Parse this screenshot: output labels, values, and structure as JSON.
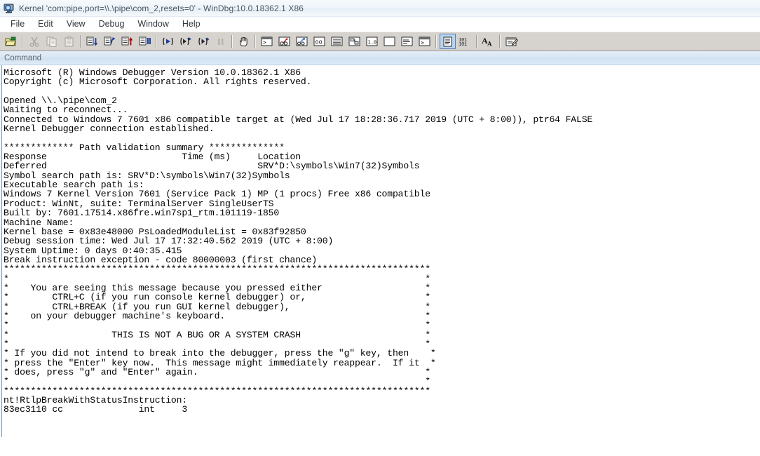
{
  "window": {
    "title": "Kernel 'com:pipe,port=\\\\.\\pipe\\com_2,resets=0' - WinDbg:10.0.18362.1 X86",
    "icon": "windbg-bug-icon"
  },
  "menubar": {
    "items": [
      {
        "label": "File",
        "name": "menu-file"
      },
      {
        "label": "Edit",
        "name": "menu-edit"
      },
      {
        "label": "View",
        "name": "menu-view"
      },
      {
        "label": "Debug",
        "name": "menu-debug"
      },
      {
        "label": "Window",
        "name": "menu-window"
      },
      {
        "label": "Help",
        "name": "menu-help"
      }
    ]
  },
  "toolbar": {
    "buttons": [
      {
        "name": "open-source-file-icon",
        "icon": "folder-open",
        "state": "enabled"
      },
      {
        "sep": true
      },
      {
        "name": "cut-icon",
        "icon": "cut",
        "state": "disabled"
      },
      {
        "name": "copy-icon",
        "icon": "copy",
        "state": "disabled"
      },
      {
        "name": "paste-icon",
        "icon": "paste",
        "state": "disabled"
      },
      {
        "sep": true
      },
      {
        "name": "step-into-icon",
        "icon": "step-into",
        "state": "enabled"
      },
      {
        "name": "step-over-icon",
        "icon": "step-over",
        "state": "enabled"
      },
      {
        "name": "step-out-icon",
        "icon": "step-out",
        "state": "enabled"
      },
      {
        "name": "run-to-cursor-icon",
        "icon": "run-to-cursor",
        "state": "enabled"
      },
      {
        "sep": true
      },
      {
        "name": "go-icon",
        "icon": "go",
        "state": "enabled"
      },
      {
        "name": "restart-icon",
        "icon": "restart",
        "state": "enabled"
      },
      {
        "name": "stop-debugging-icon",
        "icon": "stop-debug",
        "state": "enabled"
      },
      {
        "name": "break-icon",
        "icon": "break",
        "state": "disabled"
      },
      {
        "sep": true
      },
      {
        "name": "break-hand-icon",
        "icon": "hand",
        "state": "enabled"
      },
      {
        "sep": true
      },
      {
        "name": "command-window-icon",
        "icon": "command-window",
        "state": "enabled"
      },
      {
        "name": "watch-window-icon",
        "icon": "watch-window",
        "state": "enabled"
      },
      {
        "name": "locals-window-icon",
        "icon": "locals-window",
        "state": "enabled"
      },
      {
        "name": "registers-window-icon",
        "icon": "registers-window",
        "state": "enabled"
      },
      {
        "name": "memory-window-icon",
        "icon": "memory-window",
        "state": "enabled"
      },
      {
        "name": "call-stack-window-icon",
        "icon": "callstack-window",
        "state": "enabled"
      },
      {
        "name": "disassembly-window-icon",
        "icon": "disasm-window",
        "state": "enabled"
      },
      {
        "name": "scratch-pad-icon",
        "icon": "scratch-pad",
        "state": "enabled"
      },
      {
        "name": "processes-threads-icon",
        "icon": "proc-threads",
        "state": "enabled"
      },
      {
        "name": "command-browser-icon",
        "icon": "cmd-browser",
        "state": "enabled"
      },
      {
        "sep": true
      },
      {
        "name": "source-mode-icon",
        "icon": "source-mode",
        "state": "pressed"
      },
      {
        "name": "assembly-mode-icon",
        "icon": "assembly-mode",
        "state": "enabled"
      },
      {
        "sep": true
      },
      {
        "name": "font-icon",
        "icon": "font-AA",
        "state": "enabled"
      },
      {
        "sep": true
      },
      {
        "name": "options-icon",
        "icon": "options",
        "state": "enabled"
      }
    ]
  },
  "command_pane": {
    "header_label": "Command",
    "output": "Microsoft (R) Windows Debugger Version 10.0.18362.1 X86\nCopyright (c) Microsoft Corporation. All rights reserved.\n\nOpened \\\\.\\pipe\\com_2\nWaiting to reconnect...\nConnected to Windows 7 7601 x86 compatible target at (Wed Jul 17 18:28:36.717 2019 (UTC + 8:00)), ptr64 FALSE\nKernel Debugger connection established.\n\n************* Path validation summary **************\nResponse                         Time (ms)     Location\nDeferred                                       SRV*D:\\symbols\\Win7(32)Symbols\nSymbol search path is: SRV*D:\\symbols\\Win7(32)Symbols\nExecutable search path is: \nWindows 7 Kernel Version 7601 (Service Pack 1) MP (1 procs) Free x86 compatible\nProduct: WinNt, suite: TerminalServer SingleUserTS\nBuilt by: 7601.17514.x86fre.win7sp1_rtm.101119-1850\nMachine Name:\nKernel base = 0x83e48000 PsLoadedModuleList = 0x83f92850\nDebug session time: Wed Jul 17 17:32:40.562 2019 (UTC + 8:00)\nSystem Uptime: 0 days 0:40:35.415\nBreak instruction exception - code 80000003 (first chance)\n*******************************************************************************\n*                                                                             *\n*    You are seeing this message because you pressed either                   *\n*        CTRL+C (if you run console kernel debugger) or,                      *\n*        CTRL+BREAK (if you run GUI kernel debugger),                         *\n*    on your debugger machine's keyboard.                                     *\n*                                                                             *\n*                   THIS IS NOT A BUG OR A SYSTEM CRASH                       *\n*                                                                             *\n* If you did not intend to break into the debugger, press the \"g\" key, then    *\n* press the \"Enter\" key now.  This message might immediately reappear.  If it  *\n* does, press \"g\" and \"Enter\" again.                                          *\n*                                                                             *\n*******************************************************************************\nnt!RtlpBreakWithStatusInstruction:\n83ec3110 cc              int     3"
  },
  "colors": {
    "toolbar_bg": "#d6d3ce",
    "titlebar_bg": "#eef4fa",
    "cmd_header_bg": "#d6e5f4",
    "output_bg": "#ffffff",
    "output_fg": "#000000",
    "pressed_btn": "#b9d2ee"
  }
}
